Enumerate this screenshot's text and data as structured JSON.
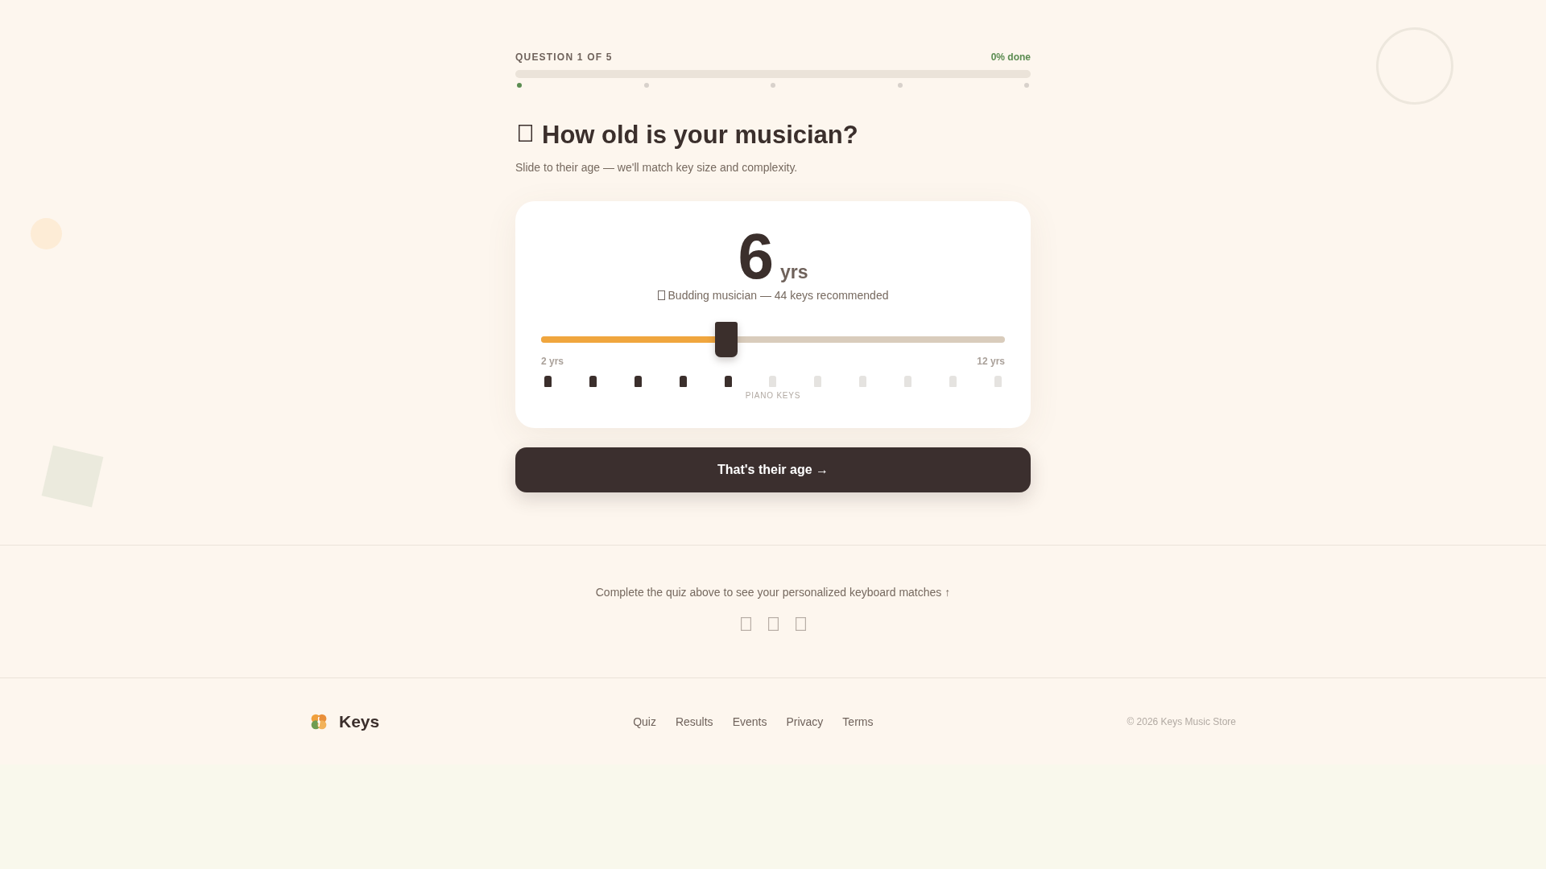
{
  "progress": {
    "label": "QUESTION 1 OF 5",
    "status": "0% done",
    "level": 0,
    "steps": [
      {
        "selected": true
      },
      {
        "selected": false
      },
      {
        "selected": false
      },
      {
        "selected": false
      },
      {
        "selected": false
      }
    ]
  },
  "question": {
    "title": "How old is your musician?",
    "subtitle": "Slide to their age — we'll match key size and complexity."
  },
  "age_card": {
    "value": "6",
    "unit": "yrs",
    "caption": "Budding musician — 44 keys recommended",
    "slider": {
      "level": 0.4,
      "min_label": "2 yrs",
      "max_label": "12 yrs"
    },
    "keys": [
      {
        "on": true
      },
      {
        "on": true
      },
      {
        "on": true
      },
      {
        "on": true
      },
      {
        "on": true
      },
      {
        "on": false
      },
      {
        "on": false
      },
      {
        "on": false
      },
      {
        "on": false
      },
      {
        "on": false
      },
      {
        "on": false
      }
    ],
    "keys_label": "PIANO KEYS"
  },
  "next_button": "That's their age →",
  "results_hint": {
    "text": "Complete the quiz above to see your personalized keyboard matches ↑"
  },
  "footer": {
    "brand": "Keys",
    "links": [
      "Quiz",
      "Results",
      "Events",
      "Privacy",
      "Terms"
    ],
    "copyright": "© 2026 Keys Music Store"
  }
}
